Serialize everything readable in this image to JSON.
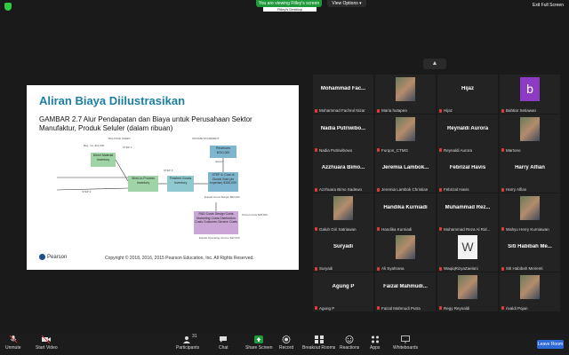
{
  "topbar": {
    "banner": "You are viewing Fitley's screen",
    "subbanner": "Fitley's Desktop",
    "view_options": "View Options ▾",
    "exit_fullscreen": "Exit Full Screen"
  },
  "slide": {
    "title": "Aliran Biaya Diilustrasikan",
    "subtitle": "GAMBAR 2.7 Alur Pendapatan dan Biaya untuk Perusahaan Sektor Manufaktur, Produk Seluler (dalam ribuan)",
    "headings": {
      "balance": "BALANCE SHEET",
      "income": "INCOME STATEMENT"
    },
    "boxes": {
      "direct": "Direct Material Inventory",
      "wip": "Work-in-Process Inventory",
      "fg": "Finished Goods Inventory",
      "revenues": "Revenues $210,000",
      "cogs": "STEP 4: Cost of Goods Sold (an expense) $150,000",
      "opcost": "R&D Costs Design Costs Marketing Costs Distribution Costs Customer-Service Costs",
      "opex": "Equals Operating Income $32,000"
    },
    "labels": {
      "step1": "STEP 1:",
      "step2": "STEP 2:",
      "step3": "STEP 3:",
      "step4": "STEP 4:",
      "begin": "Beg. Inv. $11,000",
      "deduct": "deduct",
      "gross": "Equals Gross Margin $60,000",
      "period": "Period Costs $28,000",
      "subcolumn": "Income Statement"
    },
    "pearson": "Pearson",
    "copyright": "Copyright © 2018, 2016, 2015 Pearson Education, Inc. All Rights Reserved."
  },
  "gallery": [
    {
      "name": "Mohammad  Fac...",
      "caption": "Mohammad Fachrul Nizar",
      "thumb": "none"
    },
    {
      "name": "",
      "caption": "Maria hutapea",
      "thumb": "photo"
    },
    {
      "name": "Hijaz",
      "caption": "Hijaz",
      "thumb": "none"
    },
    {
      "name": "",
      "caption": "Bahtiar Setiawan",
      "thumb": "letter-b"
    },
    {
      "name": "Nadia  Putriwibo...",
      "caption": "Nadia Putriwibowo",
      "thumb": "none"
    },
    {
      "name": "",
      "caption": "Furqon_CTMG",
      "thumb": "photo"
    },
    {
      "name": "Reynaldi Aurora",
      "caption": "Reynaldi Aurora",
      "thumb": "none"
    },
    {
      "name": "",
      "caption": "Martono",
      "thumb": "photo"
    },
    {
      "name": "Azzhuara  Bimo...",
      "caption": "Azzhuara Bimo Sadewo",
      "thumb": "none"
    },
    {
      "name": "Jeremia  Lambok...",
      "caption": "Jeremia Lambok Christian",
      "thumb": "none"
    },
    {
      "name": "Febrizal Havis",
      "caption": "Febrizal Havis",
      "thumb": "none"
    },
    {
      "name": "Harry Alfian",
      "caption": "Harry Alfian",
      "thumb": "none"
    },
    {
      "name": "",
      "caption": "Galuh Giri Satriawan",
      "thumb": "photo"
    },
    {
      "name": "Handika Kurniadi",
      "caption": "Handika Kurniadi",
      "thumb": "none"
    },
    {
      "name": "Muhammad  Rez...",
      "caption": "Muhammad Reza Al Rid...",
      "thumb": "none"
    },
    {
      "name": "",
      "caption": "Wahyu Herry Kurniawan",
      "thumb": "photo"
    },
    {
      "name": "Suryadi",
      "caption": "Suryadi",
      "thumb": "none"
    },
    {
      "name": "",
      "caption": "Ali Syahrana",
      "thumb": "photo"
    },
    {
      "name": "",
      "caption": "WaqiqRizyaZaelani",
      "thumb": "letter-w"
    },
    {
      "name": "Siti Habibah Me...",
      "caption": "Siti Habibah Meirenti",
      "thumb": "none"
    },
    {
      "name": "Agung P",
      "caption": "Agung P",
      "thumb": "none"
    },
    {
      "name": "Faizal  Mahmudi...",
      "caption": "Faizal Mahmudi Putra",
      "thumb": "none"
    },
    {
      "name": "",
      "caption": "Regy Reynaldi",
      "thumb": "photo"
    },
    {
      "name": "",
      "caption": "rivaldi Pojan",
      "thumb": "photo"
    }
  ],
  "toolbar": {
    "unmute": "Unmute",
    "video": "Start Video",
    "participants": "Participants",
    "participants_count": "31",
    "chat": "Chat",
    "share": "Share Screen",
    "record": "Record",
    "breakout": "Breakout Rooms",
    "reactions": "Reactions",
    "apps": "Apps",
    "whiteboards": "Whiteboards",
    "leave": "Leave Room"
  },
  "letters": {
    "b": "b",
    "w": "W"
  },
  "colors": {
    "accent_green": "#1f9a3a",
    "leave_blue": "#2d6ad6",
    "title_blue": "#1c7ea3",
    "mute_red": "#e03a3a"
  }
}
